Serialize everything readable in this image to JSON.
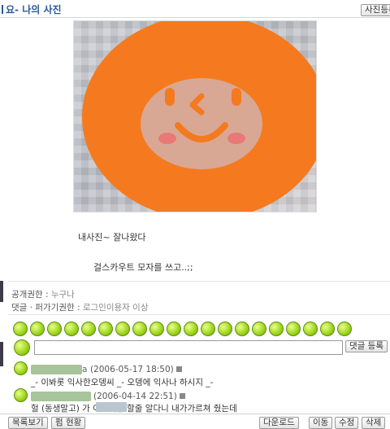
{
  "header": {
    "title": "요- 나의 사진",
    "register_button": "사진등록"
  },
  "post": {
    "caption_line1": "내사진~  잘나왔다",
    "caption_line2": "걸스카우트 모자를 쓰고..;;",
    "permission_label": "공개권한",
    "permission_value": "누구나",
    "comment_permission_label": "댓글 · 퍼가기권한",
    "comment_permission_value": "로그인이용자 이상"
  },
  "emoticons": [
    "smile-emoticon",
    "wink-emoticon",
    "laugh-emoticon",
    "shy-emoticon",
    "sad-emoticon",
    "grin-emoticon",
    "angry-emoticon",
    "surprise-emoticon",
    "cool-emoticon",
    "kiss-emoticon",
    "tongue-emoticon",
    "love-emoticon",
    "cry-emoticon",
    "devil-emoticon",
    "sleep-emoticon",
    "dizzy-emoticon",
    "shock-emoticon",
    "sweat-emoticon",
    "happy-emoticon",
    "nervous-emoticon"
  ],
  "comment_form": {
    "submit_label": "댓글 등록"
  },
  "comments": [
    {
      "author_suffix": "a",
      "date": "(2006-05-17 18:50)",
      "text": "_- 이봐롯 익사한오뎅씨 _- 오뎅에 익사나 하시지 _-"
    },
    {
      "author_suffix": "",
      "date": "(2006-04-14 22:51)",
      "text": "헐 (동생말고)         가 이딴거를 할줄 알다니 내가가르쳐 줬는데"
    }
  ],
  "footer": {
    "list_button": "목록보기",
    "stats_button": "펌 현황",
    "download_button": "다운로드",
    "move_button": "이동",
    "edit_button": "수정",
    "delete_button": "삭제"
  }
}
